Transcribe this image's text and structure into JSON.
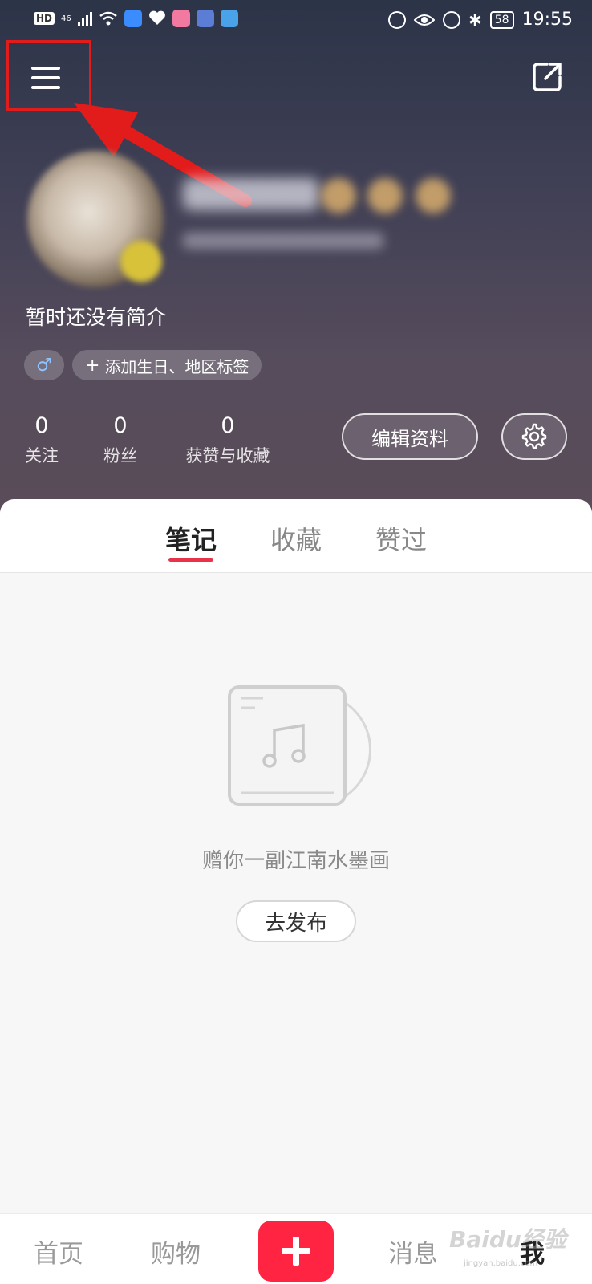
{
  "status_bar": {
    "hd": "HD",
    "network": "46",
    "battery": "58",
    "time": "19:55"
  },
  "profile": {
    "bio": "暂时还没有简介",
    "gender_symbol": "♂",
    "add_tag_label": "添加生日、地区标签"
  },
  "stats": [
    {
      "value": "0",
      "label": "关注"
    },
    {
      "value": "0",
      "label": "粉丝"
    },
    {
      "value": "0",
      "label": "获赞与收藏"
    }
  ],
  "actions": {
    "edit_profile": "编辑资料"
  },
  "tabs": [
    {
      "label": "笔记",
      "active": true
    },
    {
      "label": "收藏",
      "active": false
    },
    {
      "label": "赞过",
      "active": false
    }
  ],
  "empty_state": {
    "message": "赠你一副江南水墨画",
    "button": "去发布"
  },
  "bottom_nav": {
    "home": "首页",
    "shop": "购物",
    "messages": "消息",
    "me": "我"
  },
  "watermark": {
    "brand": "Baidu经验",
    "url": "jingyan.baidu.com"
  },
  "colors": {
    "accent": "#ff2442",
    "annotation": "#e21b1b"
  }
}
